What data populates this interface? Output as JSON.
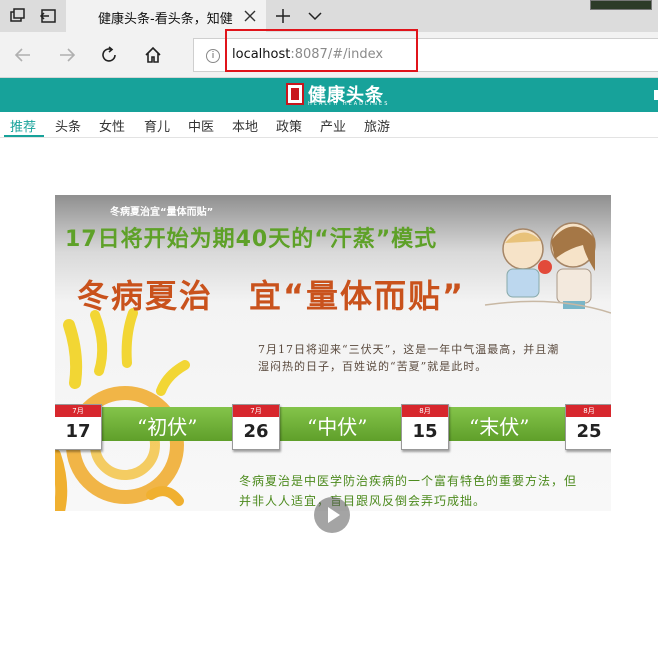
{
  "browser": {
    "tab_title": "健康头条-看头条，知健",
    "url_host": "localhost",
    "url_rest": ":8087/#/index",
    "info_symbol": "i"
  },
  "site": {
    "logo_text": "健康头条",
    "logo_sub": "HEALTH HEADLINES",
    "categories": [
      "推荐",
      "头条",
      "女性",
      "育儿",
      "中医",
      "本地",
      "政策",
      "产业",
      "旅游"
    ],
    "active_category": "推荐"
  },
  "banner": {
    "kicker": "冬病夏治宜“量体而贴”",
    "headline": "17日将开始为期40天的“汗蒸”模式",
    "title_left": "冬病夏治",
    "title_right": "宜“量体而贴”",
    "paragraph1": "7月17日将迎来“三伏天”，这是一年中气温最高，并且潮湿闷热的日子，百姓说的“苦夏”就是此时。",
    "paragraph2": "冬病夏治是中医学防治疾病的一个富有特色的重要方法，但并非人人适宜，盲目跟风反倒会弄巧成拙。",
    "phases": [
      {
        "label": "“初伏”"
      },
      {
        "label": "“中伏”"
      },
      {
        "label": "“末伏”"
      }
    ],
    "calendars": [
      {
        "month": "7月",
        "day": "17"
      },
      {
        "month": "7月",
        "day": "26"
      },
      {
        "month": "8月",
        "day": "15"
      },
      {
        "month": "8月",
        "day": "25"
      }
    ]
  },
  "colors": {
    "brand": "#17a29a",
    "highlight_box": "#e0141b",
    "calendar_red": "#d7272d",
    "phase_green": "#6fb236"
  }
}
